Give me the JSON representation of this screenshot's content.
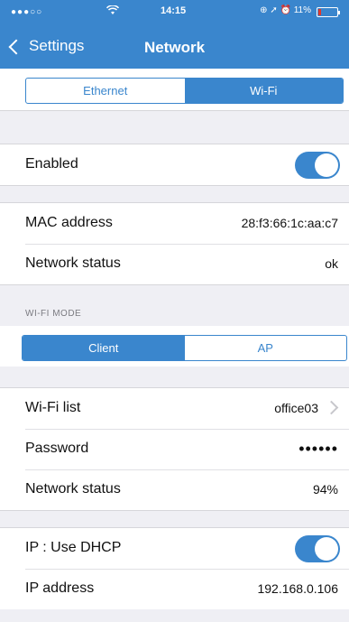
{
  "status_bar": {
    "signal": "●●●○○",
    "wifi_icon": "wifi-icon",
    "time": "14:15",
    "right_icons": "⊕ ➚ ⏰",
    "battery": "11%"
  },
  "nav": {
    "back_label": "Settings",
    "title": "Network"
  },
  "interface_tabs": {
    "ethernet": "Ethernet",
    "wifi": "Wi-Fi",
    "selected": "Wi-Fi"
  },
  "enabled_row": {
    "label": "Enabled",
    "on": true
  },
  "device_info": {
    "mac_label": "MAC address",
    "mac_value": "28:f3:66:1c:aa:c7",
    "status_label": "Network status",
    "status_value": "ok"
  },
  "wifi_mode": {
    "header": "WI-FI MODE",
    "client": "Client",
    "ap": "AP",
    "selected": "Client"
  },
  "wifi_settings": {
    "list_label": "Wi-Fi list",
    "list_value": "office03",
    "password_label": "Password",
    "password_value": "••••••",
    "status_label": "Network status",
    "status_value": "94%"
  },
  "ip_settings": {
    "dhcp_label": "IP : Use DHCP",
    "dhcp_on": true,
    "ip_label": "IP address",
    "ip_value": "192.168.0.106"
  },
  "colors": {
    "accent": "#3a86cd",
    "background": "#efeff4"
  }
}
